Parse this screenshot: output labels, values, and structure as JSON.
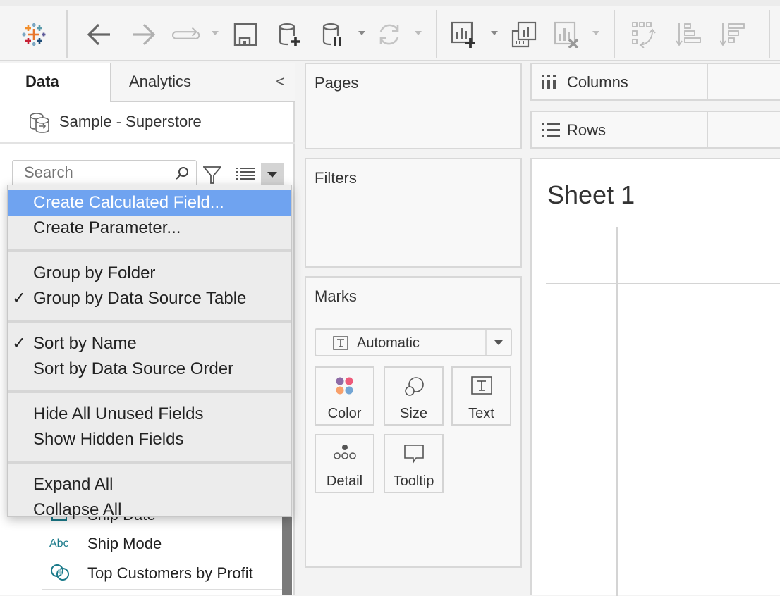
{
  "toolbar": {
    "icons": [
      "tableau-logo-icon",
      "back-icon",
      "forward-icon",
      "redo-icon",
      "save-icon",
      "new-data-source-icon",
      "pause-auto-updates-icon",
      "refresh-icon",
      "new-worksheet-icon",
      "duplicate-sheet-icon",
      "clear-sheet-icon",
      "swap-rows-columns-icon",
      "sort-ascending-icon",
      "sort-descending-icon"
    ]
  },
  "left_pane": {
    "tabs": {
      "data": "Data",
      "analytics": "Analytics"
    },
    "collapse_glyph": "<",
    "data_source": "Sample - Superstore",
    "search": {
      "placeholder": "Search",
      "value": ""
    },
    "fields": [
      {
        "type_icon": "date",
        "label": "Ship Date"
      },
      {
        "type_icon": "Abc",
        "label": "Ship Mode"
      },
      {
        "type_icon": "set",
        "label": "Top Customers by Profit"
      }
    ]
  },
  "context_menu": {
    "groups": [
      [
        {
          "label": "Create Calculated Field...",
          "highlighted": true,
          "checked": false
        },
        {
          "label": "Create Parameter...",
          "checked": false
        }
      ],
      [
        {
          "label": "Group by Folder",
          "checked": false
        },
        {
          "label": "Group by Data Source Table",
          "checked": true
        }
      ],
      [
        {
          "label": "Sort by Name",
          "checked": true
        },
        {
          "label": "Sort by Data Source Order",
          "checked": false
        }
      ],
      [
        {
          "label": "Hide All Unused Fields",
          "checked": false
        },
        {
          "label": "Show Hidden Fields",
          "checked": false
        }
      ],
      [
        {
          "label": "Expand All",
          "checked": false
        },
        {
          "label": "Collapse All",
          "checked": false
        }
      ]
    ],
    "check_glyph": "✓"
  },
  "cards": {
    "pages": "Pages",
    "filters": "Filters",
    "marks": {
      "title": "Marks",
      "mark_type": "Automatic",
      "buttons": {
        "color": "Color",
        "size": "Size",
        "text": "Text",
        "detail": "Detail",
        "tooltip": "Tooltip"
      },
      "color_dots": [
        "#8e6ba6",
        "#ee5a7a",
        "#f8a06a",
        "#73a5d4"
      ]
    }
  },
  "shelves": {
    "columns": "Columns",
    "rows": "Rows"
  },
  "sheet": {
    "title": "Sheet 1"
  },
  "colors": {
    "menu_highlight": "#6fa3f0",
    "field_icon": "#1a7a8a"
  }
}
